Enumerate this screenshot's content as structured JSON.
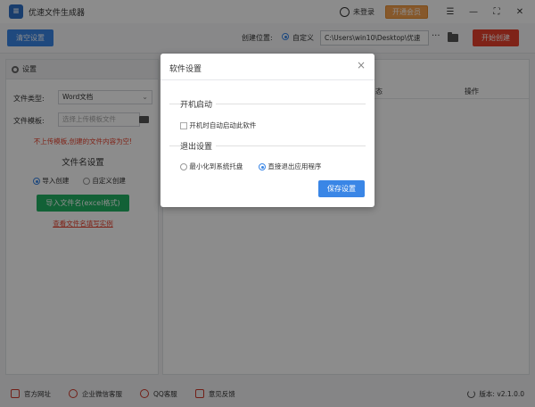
{
  "app": {
    "title": "优速文件生成器",
    "logo_glyph": "≡"
  },
  "titlebar": {
    "login_label": "未登录",
    "vip_label": "开通会员"
  },
  "toolbar": {
    "clear_label": "清空设置",
    "location_label": "创建位置:",
    "custom_label": "自定义",
    "path_value": "C:\\Users\\win10\\Desktop\\优速",
    "more_label": "···",
    "start_label": "开始创建"
  },
  "settings": {
    "header": "设置",
    "file_type_label": "文件类型:",
    "file_type_value": "Word文档",
    "template_label": "文件模板:",
    "template_placeholder": "选择上传模板文件",
    "warning": "不上传模板,创建的文件内容为空!",
    "name_section_title": "文件名设置",
    "import_option": "导入创建",
    "custom_option": "自定义创建",
    "import_button": "导入文件名(excel格式)",
    "example_link": "查看文件名填写实例"
  },
  "main": {
    "col_partial": "态",
    "col_op": "操作"
  },
  "dialog": {
    "title": "软件设置",
    "close_glyph": "×",
    "startup_title": "开机启动",
    "startup_option": "开机时自动启动此软件",
    "exit_title": "退出设置",
    "minimize_option": "最小化到系统托盘",
    "quit_option": "直接退出应用程序",
    "save_label": "保存设置"
  },
  "footer": {
    "website": "官方网址",
    "wechat": "企业微信客服",
    "qq": "QQ客服",
    "feedback": "意见反馈",
    "version": "版本: v2.1.0.0"
  },
  "colors": {
    "accent": "#3a86e6",
    "danger": "#e8412c",
    "success": "#21b163",
    "vip": "#f5a04f"
  }
}
